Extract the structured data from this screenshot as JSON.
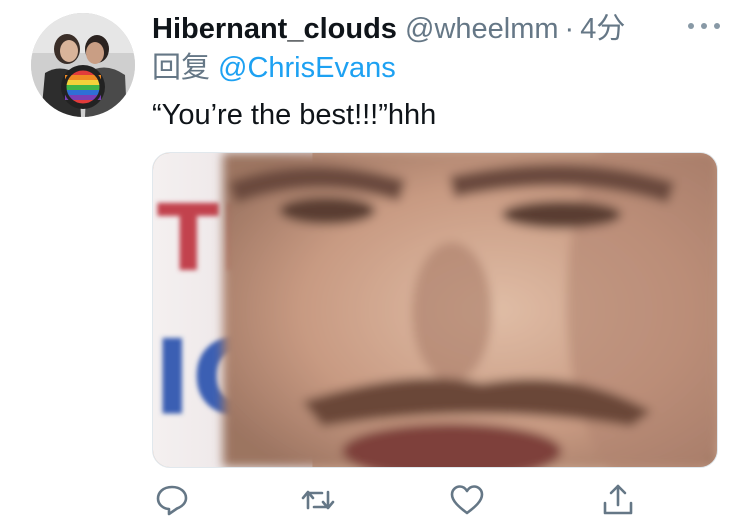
{
  "tweet": {
    "author": {
      "display_name": "Hibernant_clouds",
      "handle": "@wheelmm",
      "avatar_icon": "avatar-photo"
    },
    "separator": "·",
    "time_ago": "4分",
    "reply": {
      "prefix": "回复",
      "mention": "@ChrisEvans"
    },
    "text": "“You’re the best!!!”hhh",
    "media": {
      "kind": "photo",
      "sign_text_top": "TIM",
      "sign_text_bottom": "ICE"
    },
    "actions": [
      {
        "name": "reply",
        "icon": "reply-icon"
      },
      {
        "name": "retweet",
        "icon": "retweet-icon"
      },
      {
        "name": "like",
        "icon": "heart-icon"
      },
      {
        "name": "share",
        "icon": "share-icon"
      }
    ]
  },
  "colors": {
    "text_primary": "#0f1419",
    "text_secondary": "#657786",
    "link": "#1da1f2",
    "icon": "#657786"
  }
}
